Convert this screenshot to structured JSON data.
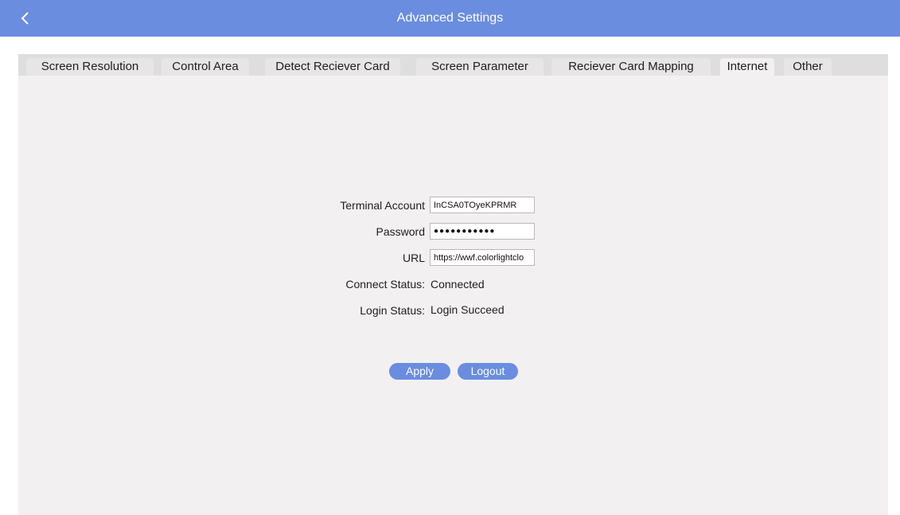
{
  "header": {
    "title": "Advanced Settings",
    "back_icon": "chevron-left-icon"
  },
  "tabs": [
    {
      "label": "Screen Resolution",
      "active": false
    },
    {
      "label": "Control Area",
      "active": false
    },
    {
      "label": "Detect Reciever Card",
      "active": false
    },
    {
      "label": "Screen Parameter",
      "active": false
    },
    {
      "label": "Reciever Card Mapping",
      "active": false
    },
    {
      "label": "Internet",
      "active": true
    },
    {
      "label": "Other",
      "active": false
    }
  ],
  "form": {
    "terminal_account_label": "Terminal Account",
    "terminal_account_value": "InCSA0TOyeKPRMR",
    "password_label": "Password",
    "password_value": "●●●●●●●●●●●",
    "url_label": "URL",
    "url_value": "https://wwf.colorlightclo",
    "connect_status_label": "Connect Status:",
    "connect_status_value": "Connected",
    "login_status_label": "Login Status:",
    "login_status_value": "Login Succeed"
  },
  "buttons": {
    "apply": "Apply",
    "logout": "Logout"
  },
  "colors": {
    "accent": "#6a8de0",
    "content_bg": "#f2f0f1",
    "tabbar_bg": "#dedede"
  }
}
